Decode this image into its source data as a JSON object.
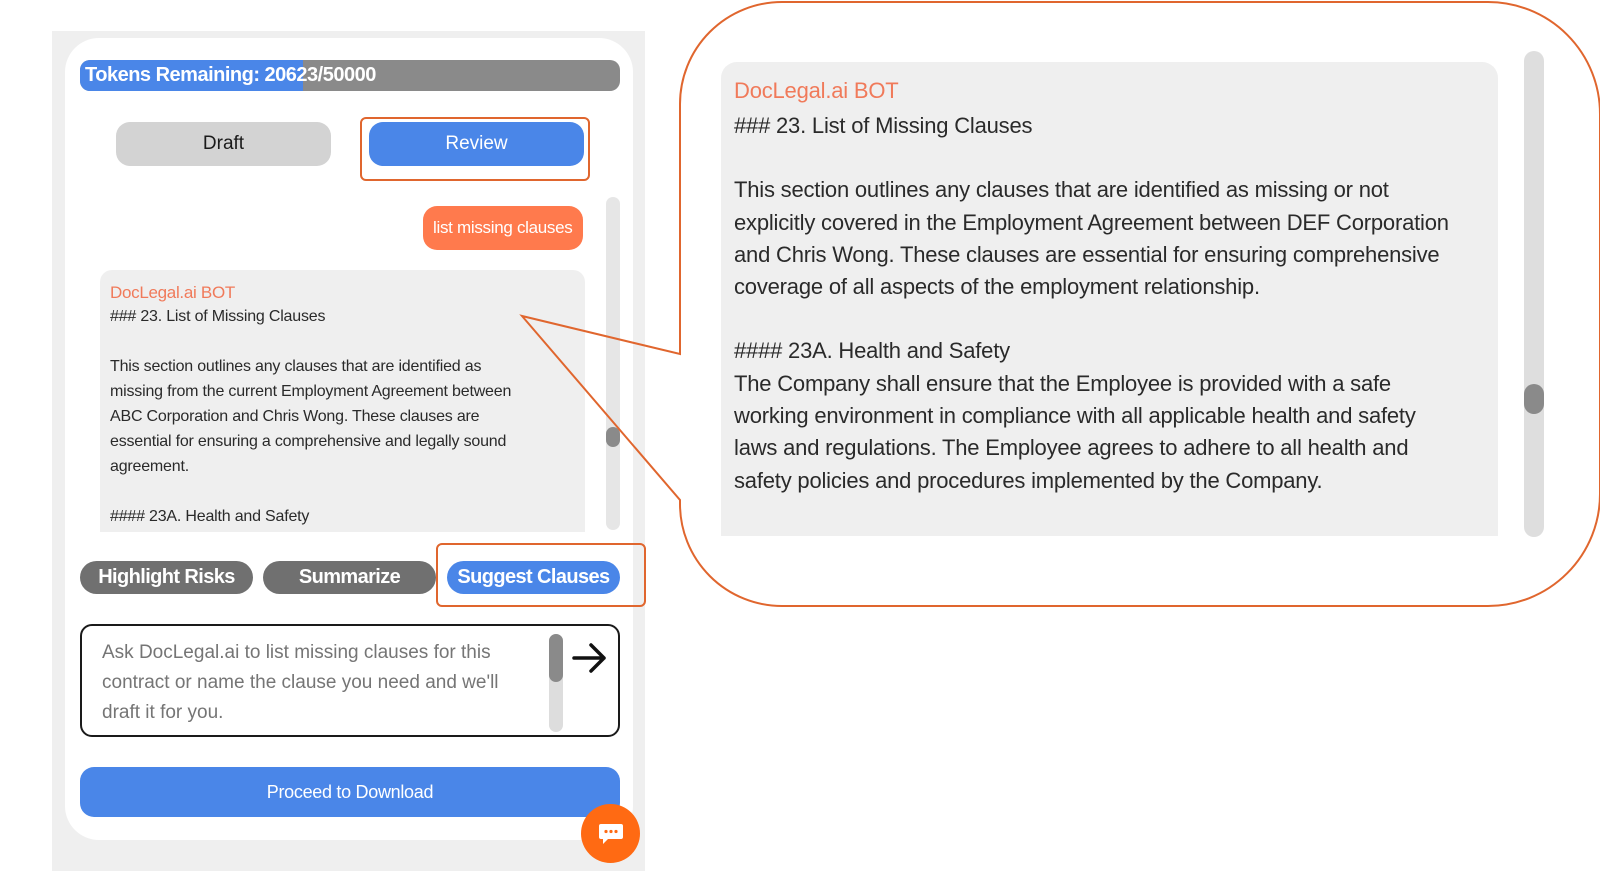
{
  "tokens": {
    "label": "Tokens Remaining: 20623/50000",
    "remaining": 20623,
    "total": 50000
  },
  "modes": {
    "draft_label": "Draft",
    "review_label": "Review",
    "selected": "Review"
  },
  "chat": {
    "user_message": "list missing clauses",
    "bot_name": "DocLegal.ai BOT",
    "bot_lines_1": [
      "### 23. List of Missing Clauses"
    ],
    "bot_lines_2": [
      "This section outlines any clauses that are identified as",
      "missing from the current Employment Agreement between",
      "ABC Corporation and Chris Wong. These clauses are",
      "essential for ensuring a comprehensive and legally sound",
      "agreement."
    ],
    "bot_lines_3": [
      "#### 23A. Health and Safety"
    ]
  },
  "actions": {
    "highlight_risks": "Highlight Risks",
    "summarize": "Summarize",
    "suggest_clauses": "Suggest Clauses"
  },
  "input": {
    "placeholder": "Ask DocLegal.ai to list missing clauses for this contract or name the clause you need and we'll draft it for you."
  },
  "download": {
    "label": "Proceed to Download"
  },
  "zoom": {
    "bot_name": "DocLegal.ai BOT",
    "heading": "### 23. List of Missing Clauses",
    "para1": [
      "This section outlines any clauses that are identified as missing or not",
      "explicitly covered in the Employment Agreement between DEF Corporation",
      "and Chris Wong. These clauses are essential for ensuring comprehensive",
      "coverage of all aspects of the employment relationship."
    ],
    "subheading": "#### 23A. Health and Safety",
    "para2": [
      "The Company shall ensure that the Employee is provided with a safe",
      "working environment in compliance with all applicable health and safety",
      "laws and regulations. The Employee agrees to adhere to all health and",
      "safety policies and procedures implemented by the Company."
    ]
  },
  "colors": {
    "accent_blue": "#4a86e8",
    "accent_orange": "#ff7a4d",
    "highlight_border": "#e0662e",
    "bot_name": "#f07a5a"
  }
}
